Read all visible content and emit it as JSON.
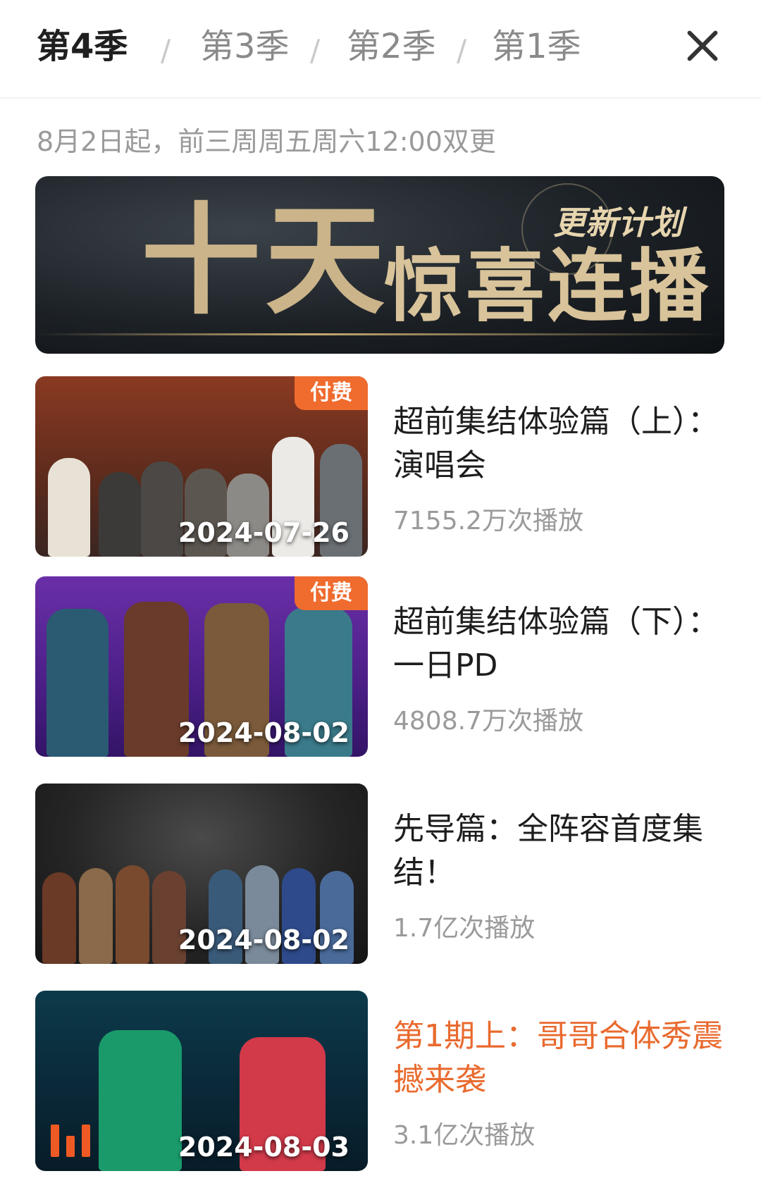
{
  "tabs": [
    {
      "label": "第4季",
      "active": true
    },
    {
      "label": "第3季",
      "active": false
    },
    {
      "label": "第2季",
      "active": false
    },
    {
      "label": "第1季",
      "active": false
    }
  ],
  "separator": "/",
  "close_icon": "close-icon",
  "schedule": "8月2日起，前三周周五周六12:00双更",
  "banner": {
    "main_big": "十天",
    "main_rest": "惊喜连播",
    "subtitle": "更新计划"
  },
  "episodes": [
    {
      "title": "超前集结体验篇（上）：演唱会",
      "badge": "付费",
      "date": "2024-07-26",
      "plays": "7155.2万次播放",
      "highlight": false
    },
    {
      "title": "超前集结体验篇（下）：一日PD",
      "badge": "付费",
      "date": "2024-08-02",
      "plays": "4808.7万次播放",
      "highlight": false
    },
    {
      "title": "先导篇：全阵容首度集结！",
      "badge": "",
      "date": "2024-08-02",
      "plays": "1.7亿次播放",
      "highlight": false
    },
    {
      "title": "第1期上：哥哥合体秀震撼来袭",
      "badge": "",
      "date": "2024-08-03",
      "plays": "3.1亿次播放",
      "highlight": true
    }
  ],
  "colors": {
    "accent": "#e96a2e",
    "badge": "#ef6b2e"
  }
}
